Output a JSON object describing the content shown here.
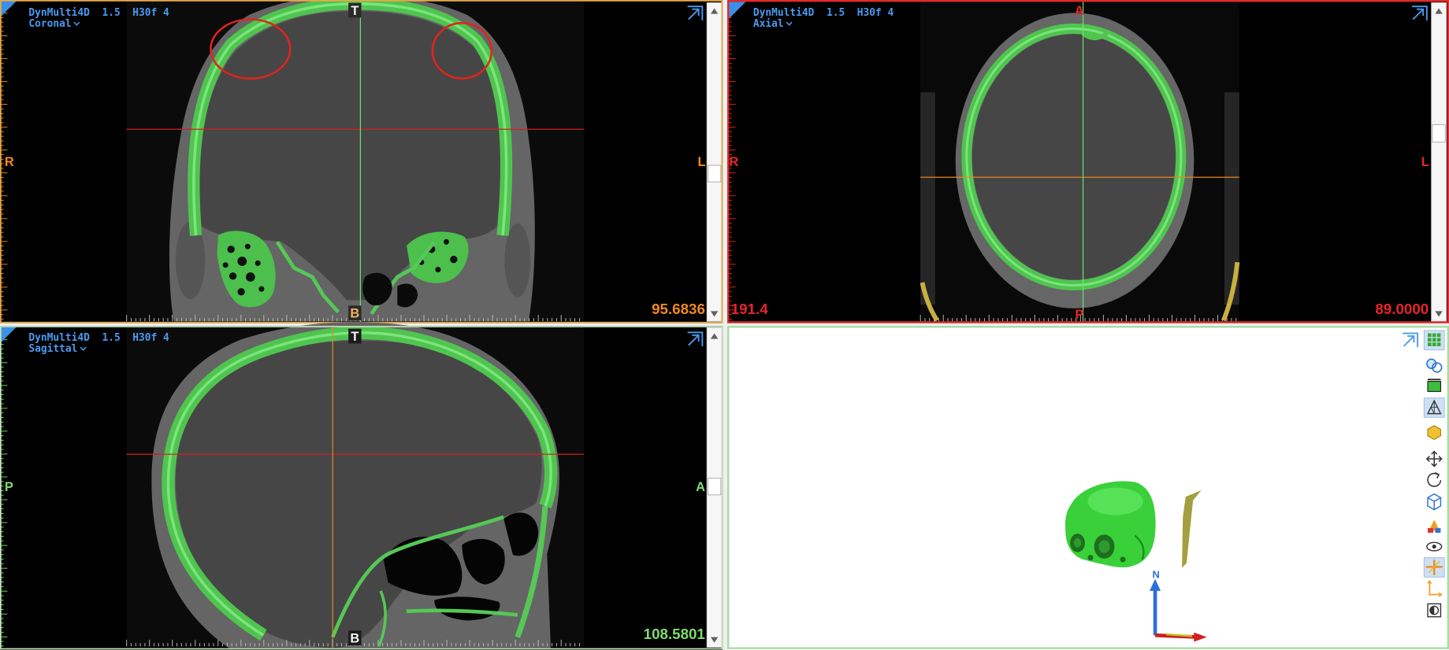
{
  "viewer": {
    "accent_color": "#3a8fe6",
    "header_color": "#4a9af0",
    "bone_color": "#5bd35b",
    "annotation_color": "#e0241c"
  },
  "coronal": {
    "header": "DynMulti4D  1.5  H30f 4",
    "view_name": "Coronal",
    "orient_top": "T",
    "orient_bottom": "B",
    "orient_left": "R",
    "orient_right": "L",
    "slice_value": "95.6836",
    "label_color": "#f28a1c",
    "border_color": "#e8a848"
  },
  "axial": {
    "header": "DynMulti4D  1.5  H30f 4",
    "view_name": "Axial",
    "orient_top": "A",
    "orient_bottom": "P",
    "orient_left": "R",
    "orient_right": "L",
    "left_value": "191.4",
    "slice_value": "89.0000",
    "label_color": "#e8242a",
    "border_color": "#e22a2a"
  },
  "sagittal": {
    "header": "DynMulti4D  1.5  H30f 4",
    "view_name": "Sagittal",
    "orient_top": "T",
    "orient_bottom": "B",
    "orient_left": "P",
    "orient_right": "A",
    "slice_value": "108.5801",
    "label_color": "#7edc6e",
    "border_color": "#c4e2bc"
  },
  "volume": {
    "axis_label": "N",
    "skull_color": "#3ad03a",
    "border_color": "#a6dca0",
    "toolbar": [
      {
        "icon": "grid-icon",
        "active": true
      },
      {
        "icon": "layers-icon",
        "active": false
      },
      {
        "icon": "frame-icon",
        "active": false
      },
      {
        "icon": "wireframe-icon",
        "active": true
      },
      {
        "icon": "surface-icon",
        "active": false
      },
      {
        "icon": "pan-icon",
        "active": false
      },
      {
        "icon": "rotate-icon",
        "active": false
      },
      {
        "icon": "cube-icon",
        "active": false
      },
      {
        "icon": "color-map-icon",
        "active": false
      },
      {
        "icon": "eye-icon",
        "active": false
      },
      {
        "icon": "axes-icon",
        "active": true
      },
      {
        "icon": "orientation-axes-icon",
        "active": false
      },
      {
        "icon": "contrast-icon",
        "active": false
      }
    ]
  }
}
